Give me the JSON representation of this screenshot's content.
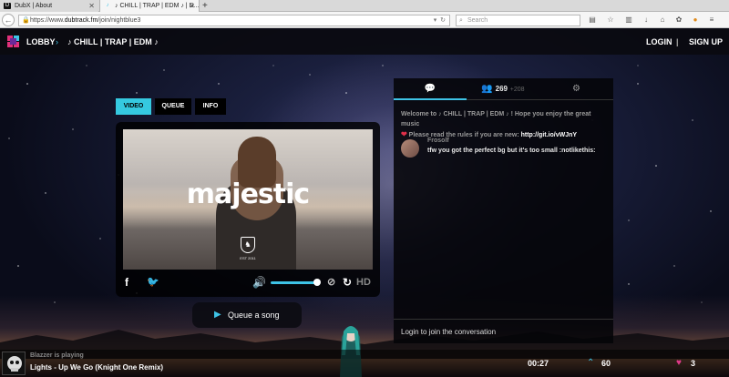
{
  "browser": {
    "tabs": [
      {
        "title": "DubX | About",
        "active": false
      },
      {
        "title": "♪ CHILL | TRAP | EDM ♪ | D...",
        "active": true
      }
    ],
    "new_tab": "+",
    "url_prefix": "https://www.",
    "url_domain": "dubtrack.fm",
    "url_path": "/join/nightblue3",
    "search_placeholder": "Search"
  },
  "header": {
    "lobby": "LOBBY",
    "room": "♪ CHILL | TRAP | EDM ♪",
    "login": "LOGIN",
    "separator": "|",
    "signup": "SIGN UP"
  },
  "player_tabs": {
    "video": "VIDEO",
    "queue": "QUEUE",
    "info": "INFO"
  },
  "video": {
    "overlay_text": "majestic",
    "badge_text": "EST 2011"
  },
  "controls": {
    "hd": "HD",
    "volume_level": 0.9
  },
  "queue_button": {
    "label": "Queue a song"
  },
  "chat": {
    "users_count": "269",
    "guests_count": "+208",
    "welcome": "Welcome to ♪ CHILL | TRAP | EDM ♪ ! Hope you enjoy the great music",
    "rules_prefix": "Please read the rules if you are new:",
    "rules_link": "http://git.io/vWJnY",
    "messages": [
      {
        "user": "Frosolf",
        "text": "tfw you got the perfect bg but it's too small :notlikethis:"
      }
    ],
    "input_placeholder": "Login to join the conversation"
  },
  "now_playing": {
    "label": "Blazzer is playing",
    "title": "Lights - Up We Go (Knight One Remix)",
    "time": "00:27",
    "updubs": "60",
    "grabs": "3"
  },
  "colors": {
    "accent": "#35c9e0",
    "grab": "#e03a8a"
  }
}
